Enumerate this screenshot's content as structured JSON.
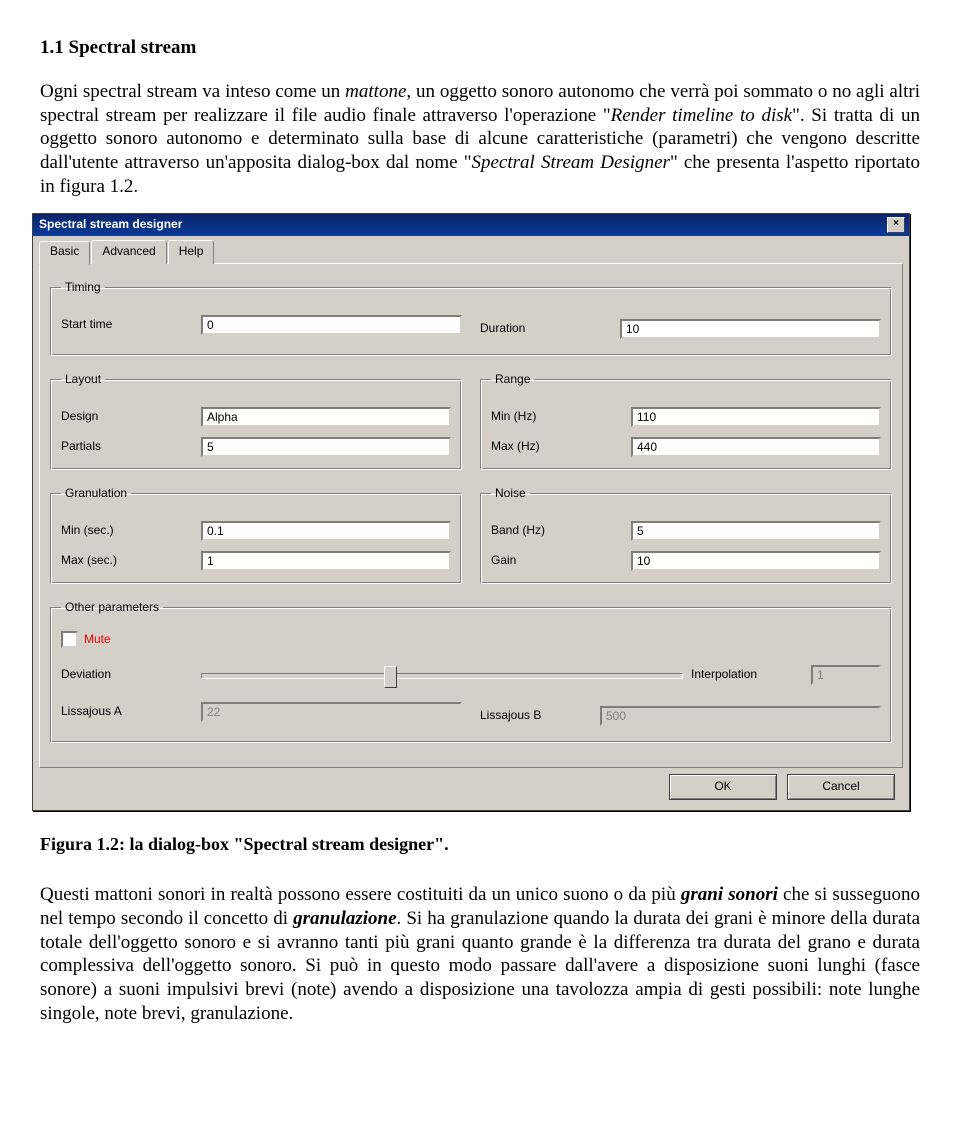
{
  "doc": {
    "heading": "1.1 Spectral stream",
    "para1_a": "Ogni spectral stream va inteso come un ",
    "para1_b_italic": "mattone",
    "para1_c": ", un oggetto sonoro autonomo che verrà poi sommato o no agli altri spectral stream per realizzare il file audio finale attraverso l'operazione \"",
    "para1_d_italic": "Render timeline to disk",
    "para1_e": "\". Si tratta di un oggetto sonoro autonomo e determinato sulla base di alcune caratteristiche (parametri) che vengono descritte dall'utente attraverso un'apposita dialog-box dal nome \"",
    "para1_f_italic": "Spectral Stream Designer",
    "para1_g": "\" che presenta l'aspetto riportato in figura 1.2.",
    "caption": "Figura 1.2: la dialog-box \"Spectral stream designer\".",
    "para2_a": "Questi mattoni sonori in realtà possono essere costituiti da un unico suono o da più ",
    "para2_b_bi": "grani sonori",
    "para2_c": " che si susseguono nel tempo secondo il concetto di ",
    "para2_d_bi": "granulazione",
    "para2_e": ". Si ha granulazione quando la durata dei grani è minore della durata totale dell'oggetto sonoro e si avranno tanti più grani quanto grande è la differenza tra durata del grano e durata complessiva dell'oggetto sonoro. Si può in questo modo passare dall'avere a disposizione suoni lunghi (fasce sonore) a suoni impulsivi brevi (note) avendo a disposizione una tavolozza ampia di gesti possibili: note lunghe singole, note brevi, granulazione."
  },
  "dialog": {
    "title": "Spectral stream designer",
    "close_x": "×",
    "tabs": {
      "basic": "Basic",
      "advanced": "Advanced",
      "help": "Help"
    },
    "groups": {
      "timing": "Timing",
      "layout": "Layout",
      "range": "Range",
      "granulation": "Granulation",
      "noise": "Noise",
      "other": "Other parameters"
    },
    "labels": {
      "start_time": "Start time",
      "duration": "Duration",
      "design": "Design",
      "partials": "Partials",
      "min_hz": "Min (Hz)",
      "max_hz": "Max (Hz)",
      "min_sec": "Min (sec.)",
      "max_sec": "Max (sec.)",
      "band_hz": "Band (Hz)",
      "gain": "Gain",
      "mute": "Mute",
      "deviation": "Deviation",
      "interpolation": "Interpolation",
      "liss_a": "Lissajous A",
      "liss_b": "Lissajous B"
    },
    "values": {
      "start_time": "0",
      "duration": "10",
      "design": "Alpha",
      "partials": "5",
      "min_hz": "110",
      "max_hz": "440",
      "min_sec": "0.1",
      "max_sec": "1",
      "band_hz": "5",
      "gain": "10",
      "interpolation": "1",
      "liss_a": "22",
      "liss_b": "500"
    },
    "buttons": {
      "ok": "OK",
      "cancel": "Cancel"
    }
  }
}
